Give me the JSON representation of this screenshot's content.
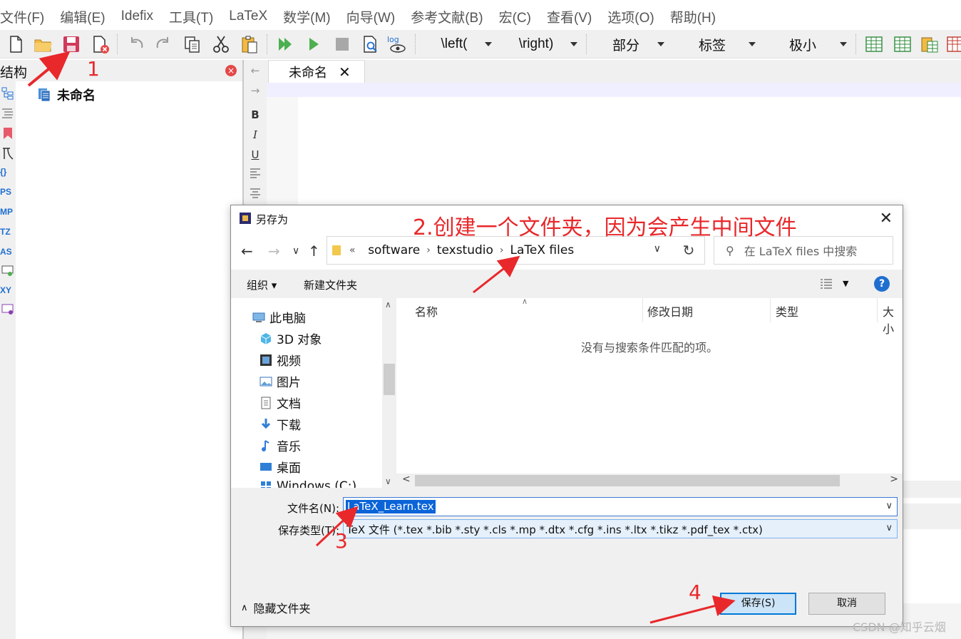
{
  "window": {
    "menu": [
      "文件(F)",
      "编辑(E)",
      "Idefix",
      "工具(T)",
      "LaTeX",
      "数学(M)",
      "向导(W)",
      "参考文献(B)",
      "宏(C)",
      "查看(V)",
      "选项(O)",
      "帮助(H)"
    ]
  },
  "toolbar": {
    "combos": [
      "\\left(",
      "\\right)",
      "部分",
      "标签",
      "极小"
    ],
    "icons": [
      "new-file-icon",
      "open-folder-icon",
      "save-icon",
      "close-file-icon",
      "undo-icon",
      "redo-icon",
      "copy-icon",
      "cut-icon",
      "paste-icon",
      "build-view-icon",
      "compile-icon",
      "stop-icon",
      "view-pdf-icon",
      "view-log-icon",
      "table-icon"
    ]
  },
  "structure": {
    "title": "结构",
    "side_items": [
      "{}",
      "PS",
      "MP",
      "TZ",
      "AS",
      "XY"
    ],
    "root_node": "未命名"
  },
  "editor": {
    "tab_label": "未命名",
    "vbar": [
      "←",
      "→",
      "B",
      "I",
      "U"
    ]
  },
  "dialog": {
    "title": "另存为",
    "breadcrumb": [
      "software",
      "texstudio",
      "LaTeX files"
    ],
    "breadcrumb_prefix": "«",
    "search_placeholder": "在 LaTeX files 中搜索",
    "organize": "组织 ▾",
    "new_folder": "新建文件夹",
    "help": "?",
    "nav_pane": [
      "此电脑",
      "3D 对象",
      "视频",
      "图片",
      "文档",
      "下载",
      "音乐",
      "桌面",
      "Windows (C:)"
    ],
    "columns": [
      "名称",
      "修改日期",
      "类型",
      "大小"
    ],
    "empty_message": "没有与搜索条件匹配的项。",
    "filename_label": "文件名(N):",
    "filename_value": "LaTeX_Learn.tex",
    "filetype_label": "保存类型(T):",
    "filetype_value": "TeX 文件 (*.tex *.bib *.sty *.cls *.mp *.dtx *.cfg *.ins *.ltx *.tikz *.pdf_tex *.ctx)",
    "hide_folders": "隐藏文件夹",
    "save_button": "保存(S)",
    "cancel_button": "取消"
  },
  "annotations": {
    "step1": "1",
    "step2": "2.创建一个文件夹，因为会产生中间文件",
    "step3": "3",
    "step4": "4",
    "color": "#e8282b"
  },
  "watermark": "CSDN @知乎云烟"
}
